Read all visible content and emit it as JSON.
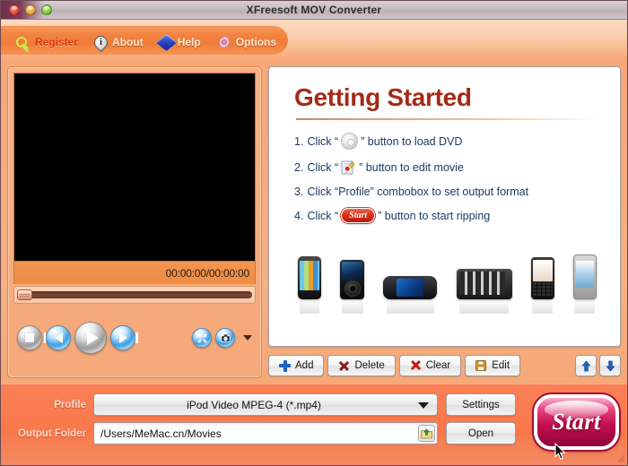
{
  "window": {
    "title": "XFreesoft MOV Converter",
    "traffic_lights": [
      "close",
      "minimize",
      "zoom"
    ]
  },
  "toolbar": {
    "items": [
      {
        "label": "Register",
        "icon": "key-icon"
      },
      {
        "label": "About",
        "icon": "info-icon"
      },
      {
        "label": "Help",
        "icon": "help-book-icon"
      },
      {
        "label": "Options",
        "icon": "gear-icon"
      }
    ]
  },
  "preview": {
    "time_display": "00:00:00/00:00:00",
    "seek_position_percent": 0,
    "controls": [
      {
        "name": "stop-button",
        "icon": "stop-icon"
      },
      {
        "name": "previous-button",
        "icon": "previous-icon"
      },
      {
        "name": "play-button",
        "icon": "play-icon"
      },
      {
        "name": "next-button",
        "icon": "next-icon"
      },
      {
        "name": "fullscreen-button",
        "icon": "fullscreen-icon"
      },
      {
        "name": "snapshot-button",
        "icon": "snapshot-icon"
      }
    ]
  },
  "getting_started": {
    "title": "Getting Started",
    "steps": [
      {
        "num": "1.",
        "pre": "Click “",
        "icon": "dvd-disc-icon",
        "post": "” button to load DVD"
      },
      {
        "num": "2.",
        "pre": "Click “",
        "icon": "edit-movie-icon",
        "post": "” button to edit movie"
      },
      {
        "num": "3.",
        "pre": "Click “Profile” combobox to set output format",
        "icon": null,
        "post": ""
      },
      {
        "num": "4.",
        "pre": "Click “",
        "icon": "start-pill-icon",
        "icon_label": "Start",
        "post": "” button to start ripping"
      }
    ],
    "devices": [
      "iphone",
      "ipod-classic",
      "psp",
      "portable-media-player",
      "blackberry",
      "pda-phone"
    ]
  },
  "actions": {
    "buttons": [
      {
        "label": "Add",
        "icon": "plus-icon"
      },
      {
        "label": "Delete",
        "icon": "x-outline-icon"
      },
      {
        "label": "Clear",
        "icon": "x-solid-icon"
      },
      {
        "label": "Edit",
        "icon": "save-edit-icon"
      }
    ],
    "move_up": "move-up-icon",
    "move_down": "move-down-icon"
  },
  "bottom": {
    "profile_label": "Profile",
    "profile_value": "iPod Video MPEG-4 (*.mp4)",
    "settings_label": "Settings",
    "output_label": "Output Folder",
    "output_value": "/Users/MeMac.cn/Movies",
    "output_placeholder": "/Users/MeMac.cn/Movies",
    "browse_icon": "folder-browse-icon",
    "open_label": "Open",
    "start_label": "Start"
  },
  "colors": {
    "window_bg": "#f7b183",
    "toolbar_pill": "#ef7b36",
    "bottom_bar": "#fa7d52",
    "title_red": "#a32a18",
    "step_text": "#1b3a63",
    "start_pink": "#c41050",
    "register_red": "#d93a14"
  }
}
